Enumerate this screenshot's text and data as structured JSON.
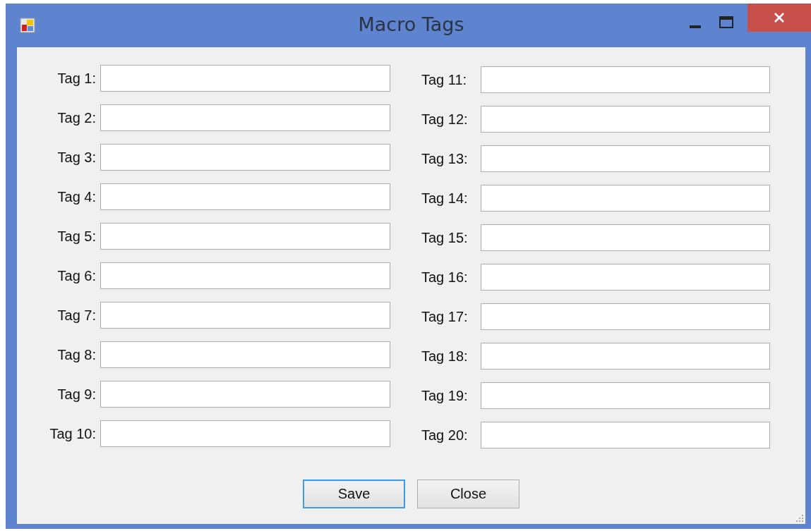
{
  "window": {
    "title": "Macro Tags"
  },
  "columns": [
    {
      "tags": [
        {
          "label": "Tag 1:"
        },
        {
          "label": "Tag 2:"
        },
        {
          "label": "Tag 3:"
        },
        {
          "label": "Tag 4:"
        },
        {
          "label": "Tag 5:"
        },
        {
          "label": "Tag 6:"
        },
        {
          "label": "Tag 7:"
        },
        {
          "label": "Tag 8:"
        },
        {
          "label": "Tag 9:"
        },
        {
          "label": "Tag 10:"
        }
      ]
    },
    {
      "tags": [
        {
          "label": "Tag 11:"
        },
        {
          "label": "Tag 12:"
        },
        {
          "label": "Tag 13:"
        },
        {
          "label": "Tag 14:"
        },
        {
          "label": "Tag 15:"
        },
        {
          "label": "Tag 16:"
        },
        {
          "label": "Tag 17:"
        },
        {
          "label": "Tag 18:"
        },
        {
          "label": "Tag 19:"
        },
        {
          "label": "Tag 20:"
        }
      ]
    }
  ],
  "buttons": [
    {
      "label": "Save",
      "focused": true
    },
    {
      "label": "Close",
      "focused": false
    }
  ]
}
